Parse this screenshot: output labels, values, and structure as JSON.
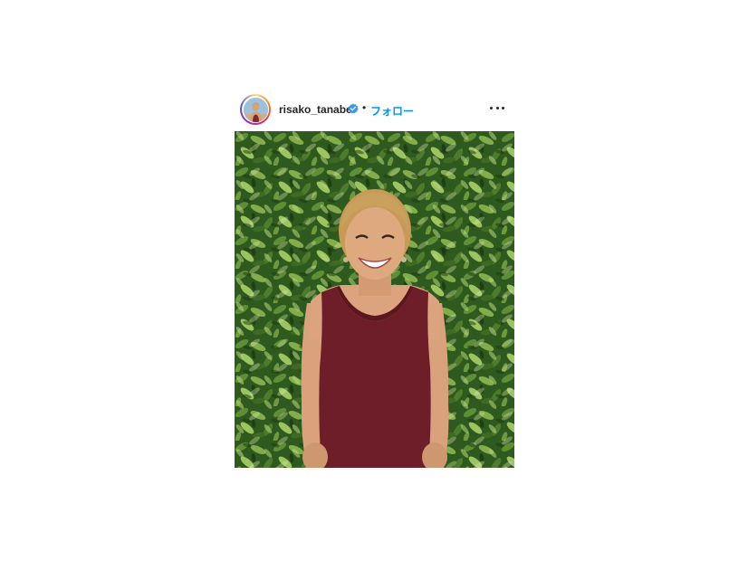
{
  "post": {
    "username": "risako_tanabe",
    "separator": "•",
    "follow_label": "フォロー",
    "avatar_icon": "profile-avatar",
    "verified_icon": "verified-badge-icon",
    "more_icon": "more-options-icon"
  },
  "colors": {
    "follow": "#0095f6",
    "verified": "#3897f0",
    "text": "#262626"
  }
}
